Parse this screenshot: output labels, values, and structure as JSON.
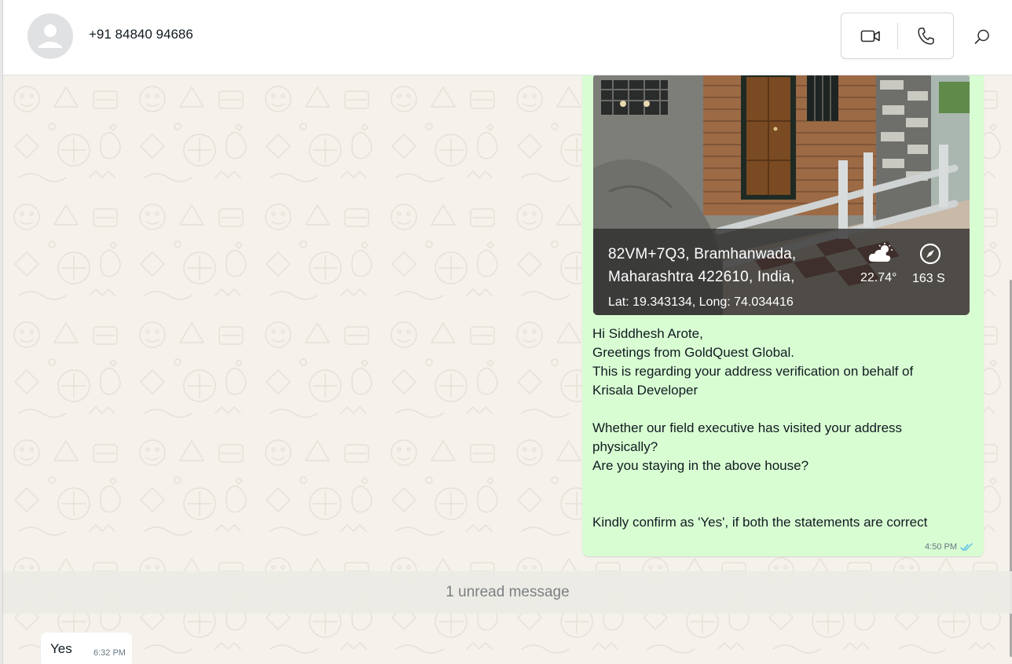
{
  "header": {
    "contact_name": "+91 84840 94686",
    "video_icon": "video-camera-icon",
    "phone_icon": "phone-icon",
    "search_icon": "search-icon"
  },
  "messages": {
    "outgoing": {
      "photo_overlay": {
        "address_line1": "82VM+7Q3, Bramhanwada,",
        "address_line2": "Maharashtra 422610, India,",
        "lat_long": "Lat: 19.343134, Long: 74.034416",
        "temperature": "22.74°",
        "heading": "163 S",
        "weather_icon": "cloud-sun-icon",
        "compass_icon": "compass-icon"
      },
      "lines": [
        "Hi Siddhesh Arote,",
        "Greetings from GoldQuest Global.",
        "This is regarding your address verification on behalf of",
        "Krisala Developer",
        "",
        "Whether our field executive has visited your address",
        "physically?",
        "Are you staying in the above house?",
        "",
        "",
        "Kindly confirm as 'Yes', if both the statements are correct"
      ],
      "time": "4:50 PM",
      "status_icon": "double-check-icon"
    },
    "unread_banner": "1 unread message",
    "incoming": {
      "text": "Yes",
      "time": "6:32 PM"
    }
  },
  "colors": {
    "outgoing_bubble": "#d9fdd3",
    "incoming_bubble": "#ffffff",
    "chat_background": "#f5f1eb",
    "read_tick": "#53bdeb"
  }
}
